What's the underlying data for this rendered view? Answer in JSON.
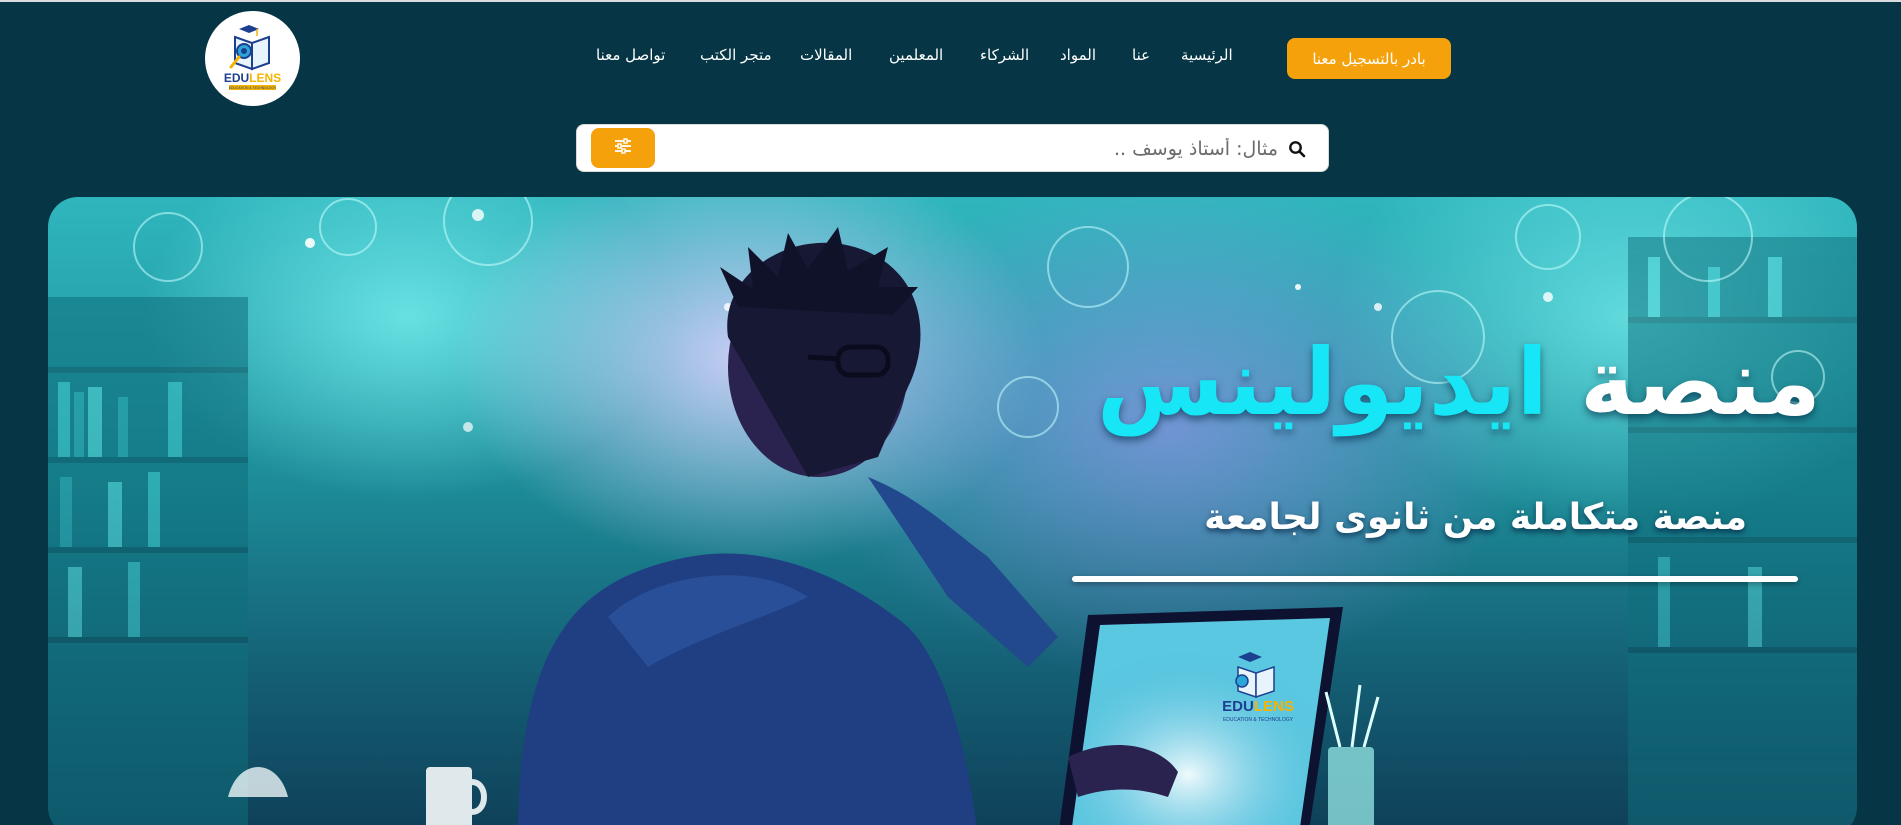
{
  "header": {
    "logo": {
      "brand_word_1": "EDU",
      "brand_word_2": "LENS",
      "tagline": "EDUCATION & TECHNOLOGY"
    },
    "register_button": "بادر بالتسجيل معنا",
    "nav": [
      {
        "id": "home",
        "label": "الرئيسية"
      },
      {
        "id": "about",
        "label": "عنا"
      },
      {
        "id": "subjects",
        "label": "المواد"
      },
      {
        "id": "partners",
        "label": "الشركاء"
      },
      {
        "id": "teachers",
        "label": "المعلمين"
      },
      {
        "id": "articles",
        "label": "المقالات"
      },
      {
        "id": "bookstore",
        "label": "متجر الكتب"
      },
      {
        "id": "contact",
        "label": "تواصل معنا"
      }
    ]
  },
  "search": {
    "placeholder": "مثال: أستاذ يوسف ..",
    "icon": "search-icon",
    "filter_icon": "sliders-icon"
  },
  "hero": {
    "title_word_1": "منصة",
    "title_word_2": "ايديولينس",
    "subtitle": "منصة متكاملة من ثانوى لجامعة",
    "laptop_logo": {
      "brand_word_1": "EDU",
      "brand_word_2": "LENS",
      "tagline": "EDUCATION & TECHNOLOGY"
    }
  },
  "colors": {
    "background": "#063645",
    "accent": "#f5a10b",
    "title_cyan": "#16e6f5",
    "brand_blue": "#1c3f8f",
    "brand_yellow": "#f5b400"
  }
}
